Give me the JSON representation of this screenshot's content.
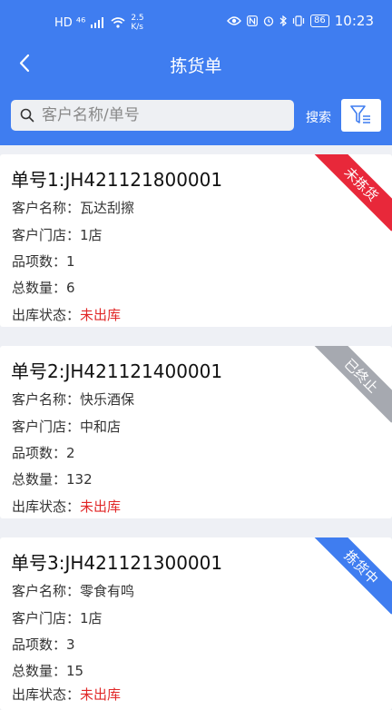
{
  "status_bar": {
    "network": "HD ⁴⁶",
    "speed_value": "2.5",
    "speed_unit": "K/s",
    "battery": "86",
    "time": "10:23"
  },
  "header": {
    "title": "拣货单"
  },
  "search": {
    "placeholder": "客户名称/单号",
    "button_label": "搜索"
  },
  "labels": {
    "customer": "客户名称：",
    "store": "客户门店：",
    "items": "品项数：",
    "qty": "总数量：",
    "status": "出库状态："
  },
  "colors": {
    "primary": "#3f7df0",
    "status_red": "#e12828",
    "ribbon_red": "#e8283a",
    "ribbon_gray": "#a6a9b0",
    "ribbon_blue": "#3f7df0"
  },
  "orders": [
    {
      "order_no": "单号1:JH421121800001",
      "customer": "瓦达刮擦",
      "store": "1店",
      "items": "1",
      "qty": "6",
      "status": "未出库",
      "ribbon": "未拣货"
    },
    {
      "order_no": "单号2:JH421121400001",
      "customer": "快乐酒保",
      "store": "中和店",
      "items": "2",
      "qty": "132",
      "status": "未出库",
      "ribbon": "已终止"
    },
    {
      "order_no": "单号3:JH421121300001",
      "customer": "零食有鸣",
      "store": "1店",
      "items": "3",
      "qty": "15",
      "status": "未出库",
      "ribbon": "拣货中"
    }
  ]
}
